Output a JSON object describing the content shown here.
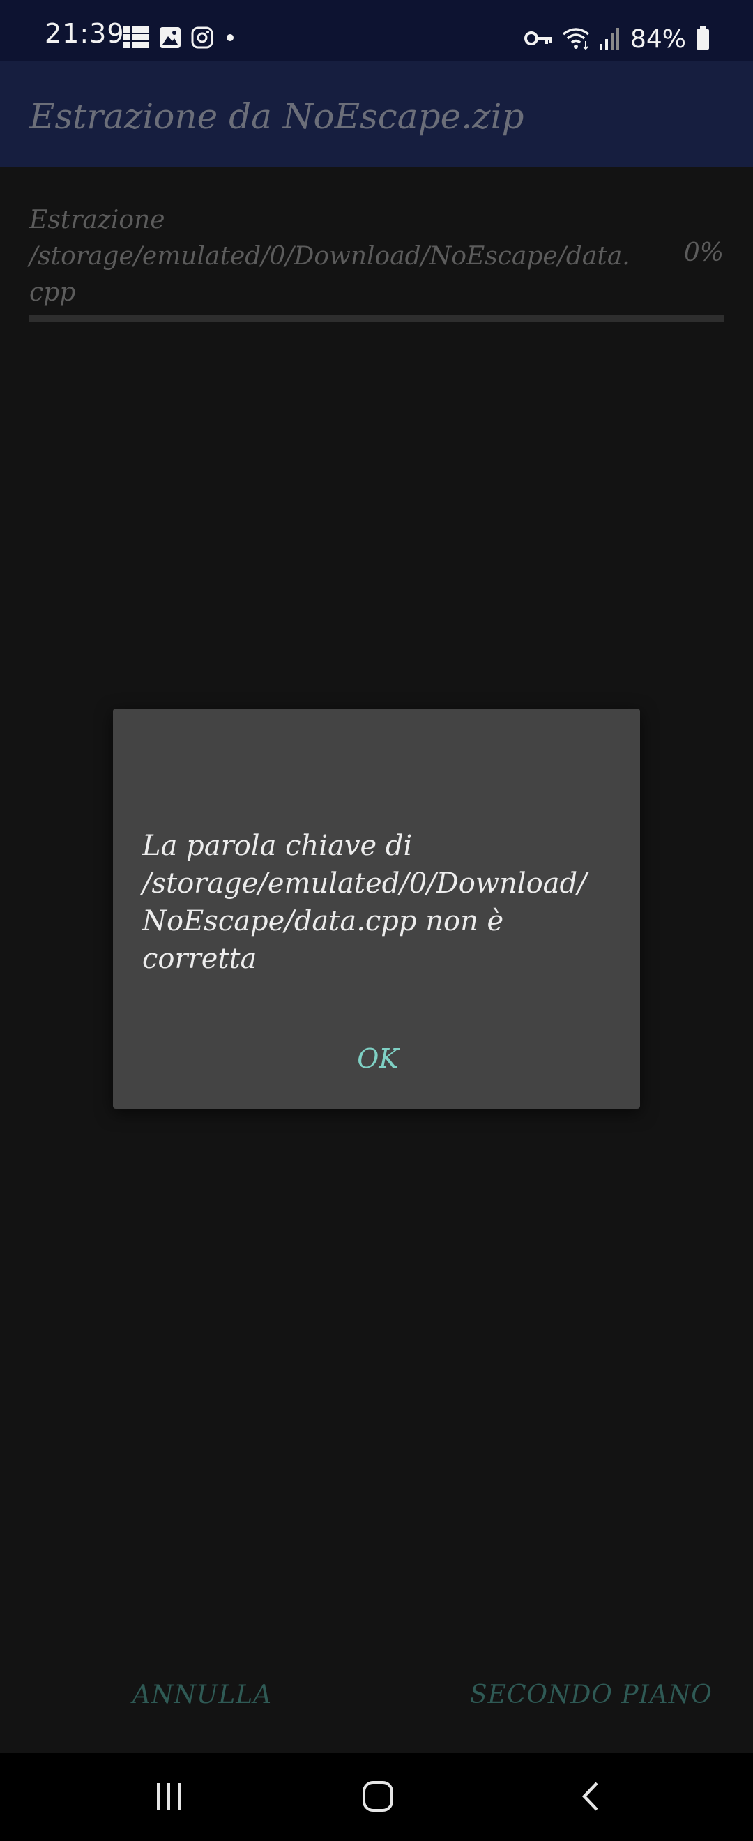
{
  "status_bar": {
    "time": "21:39",
    "battery": "84%",
    "icons_left": [
      "grid-notification-icon",
      "gallery-icon",
      "instagram-icon",
      "dot-icon"
    ],
    "icons_right": [
      "vpn-key-icon",
      "wifi-icon",
      "signal-icon",
      "battery-icon"
    ]
  },
  "app_bar": {
    "title": "Estrazione da NoEscape.zip"
  },
  "progress": {
    "label": "Estrazione",
    "path": "/storage/emulated/0/Download/NoEscape/data.cpp",
    "percent_text": "0%",
    "value": 0
  },
  "dialog": {
    "message": "La parola chiave di /storage/emulated/0/Download/NoEscape/data.cpp non è corretta",
    "ok_label": "OK"
  },
  "actions": {
    "cancel_label": "ANNULLA",
    "background_label": "SECONDO PIANO"
  },
  "colors": {
    "status_bar_bg": "#0d1331",
    "app_bar_bg": "#161e3f",
    "background": "#131313",
    "dialog_bg": "#444444",
    "accent": "#7fd0c4"
  }
}
